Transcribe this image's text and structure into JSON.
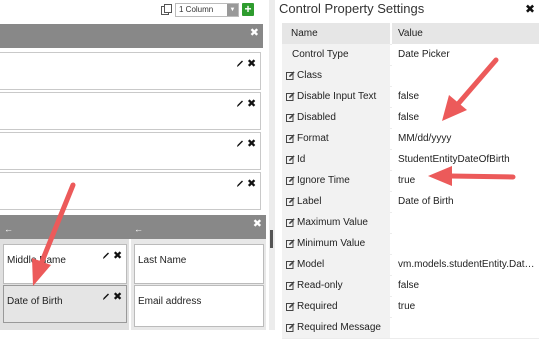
{
  "toolbar": {
    "icons": {
      "layout": "layout-icon",
      "add": "plus-icon"
    },
    "columns_value": "1 Column",
    "add_label": "+"
  },
  "designer": {
    "close_glyph": "✖",
    "back_glyph": "←",
    "fields": [
      {
        "label": "Middle Name"
      },
      {
        "label": "Last Name"
      },
      {
        "label": "Date of Birth"
      },
      {
        "label": "Email address"
      }
    ]
  },
  "panel": {
    "title": "Control Property Settings",
    "close_glyph": "✖",
    "columns": {
      "name": "Name",
      "value": "Value"
    },
    "rows": [
      {
        "name": "Control Type",
        "value": "Date Picker",
        "editable": false
      },
      {
        "name": "Class",
        "value": "",
        "editable": true
      },
      {
        "name": "Disable Input Text",
        "value": "false",
        "editable": true
      },
      {
        "name": "Disabled",
        "value": "false",
        "editable": true
      },
      {
        "name": "Format",
        "value": "MM/dd/yyyy",
        "editable": true
      },
      {
        "name": "Id",
        "value": "StudentEntityDateOfBirth",
        "editable": true
      },
      {
        "name": "Ignore Time",
        "value": "true",
        "editable": true
      },
      {
        "name": "Label",
        "value": "Date of Birth",
        "editable": true
      },
      {
        "name": "Maximum Value",
        "value": "",
        "editable": true
      },
      {
        "name": "Minimum Value",
        "value": "",
        "editable": true
      },
      {
        "name": "Model",
        "value": "vm.models.studentEntity.Dat…",
        "editable": true
      },
      {
        "name": "Read-only",
        "value": "false",
        "editable": true
      },
      {
        "name": "Required",
        "value": "true",
        "editable": true
      },
      {
        "name": "Required Message",
        "value": "",
        "editable": true
      }
    ]
  },
  "colors": {
    "annotation_arrow": "#ec5a5a",
    "add_button": "#2e9c2e",
    "section_header": "#888888"
  }
}
